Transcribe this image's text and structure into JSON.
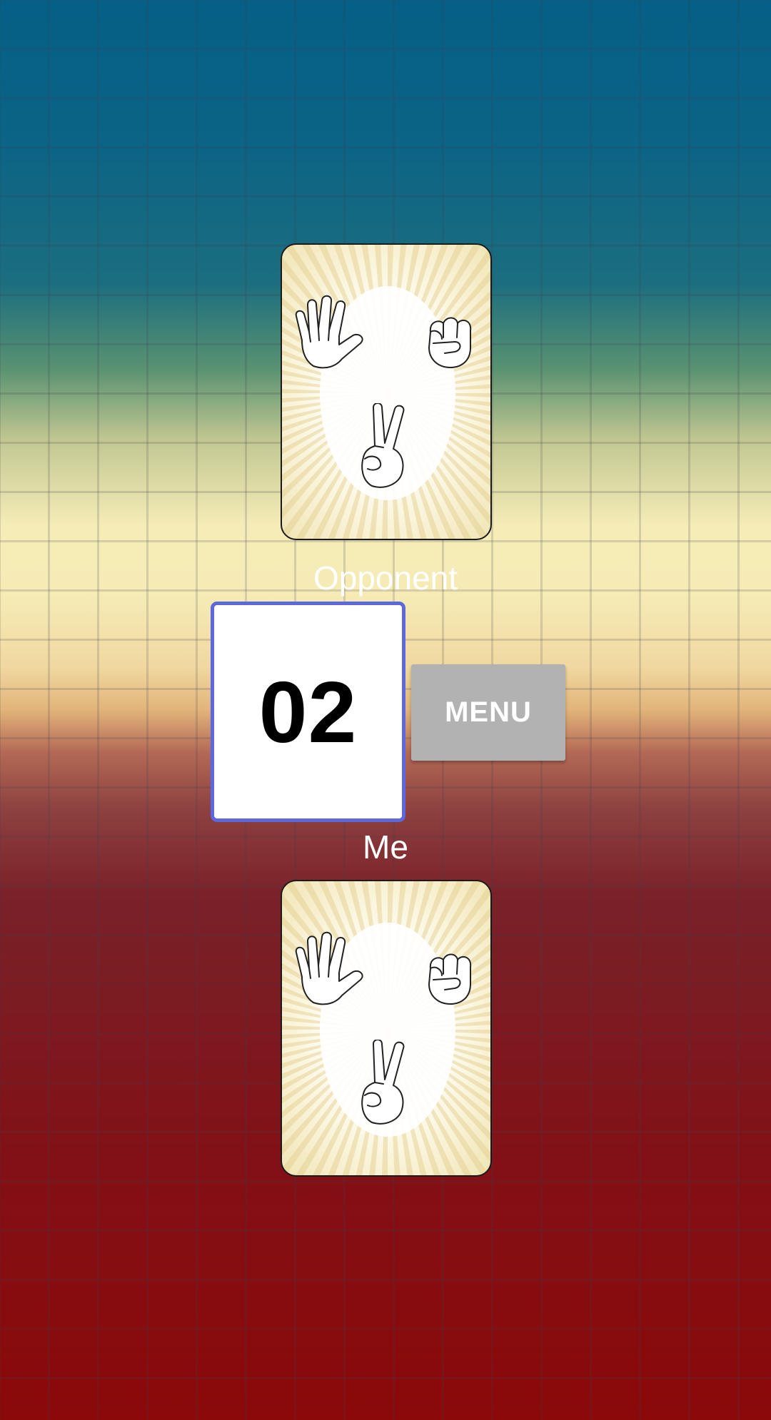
{
  "opponent": {
    "label": "Opponent",
    "card": {
      "state": "face-down",
      "icons": [
        "open-hand-icon",
        "fist-icon",
        "peace-sign-icon"
      ]
    }
  },
  "score": {
    "value": "02"
  },
  "menu_button": {
    "label": "MENU"
  },
  "player": {
    "label": "Me",
    "card": {
      "state": "face-down",
      "icons": [
        "open-hand-icon",
        "fist-icon",
        "peace-sign-icon"
      ]
    }
  },
  "colors": {
    "score_border": "#5d67de",
    "menu_button_bg": "#b2b2b2",
    "background_top": "#055f86",
    "background_middle": "#f5ecb7",
    "background_bottom": "#8b0909"
  }
}
